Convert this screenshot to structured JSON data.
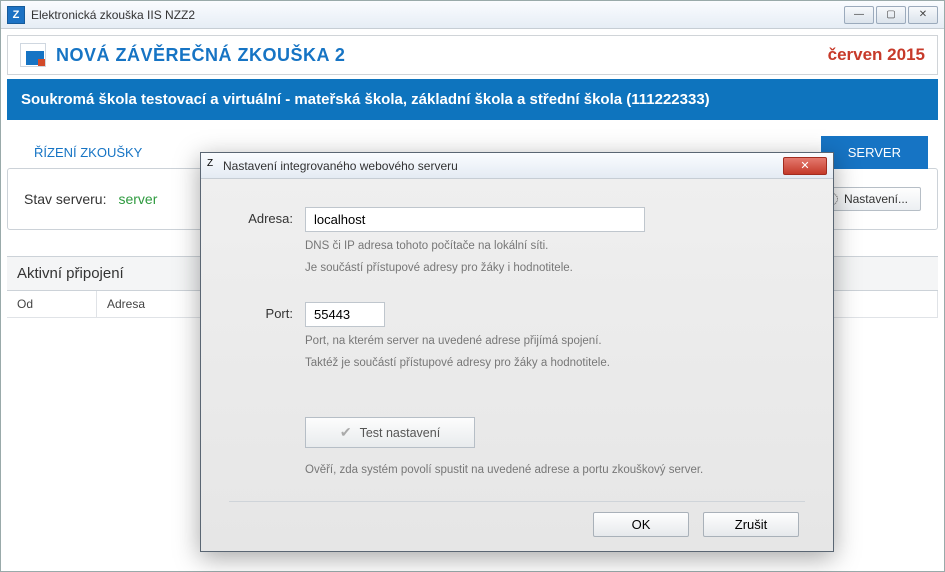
{
  "window": {
    "title": "Elektronická zkouška IIS NZZ2",
    "icon_text": "Z"
  },
  "header": {
    "title": "NOVÁ ZÁVĚREČNÁ ZKOUŠKA 2",
    "date": "červen 2015"
  },
  "subheader": "Soukromá škola testovací a virtuální - mateřská škola, základní škola a střední škola (111222333)",
  "tabs": {
    "left": "ŘÍZENÍ ZKOUŠKY",
    "server": "SERVER"
  },
  "server_status": {
    "label": "Stav serveru:",
    "value": "server",
    "settings_label": "Nastavení..."
  },
  "connections": {
    "title": "Aktivní připojení",
    "columns": {
      "od": "Od",
      "adresa": "Adresa"
    }
  },
  "dialog": {
    "title": "Nastavení integrovaného webového serveru",
    "address_label": "Adresa:",
    "address_value": "localhost",
    "address_hint1": "DNS či IP adresa tohoto počítače na lokální síti.",
    "address_hint2": "Je součástí přístupové adresy pro žáky i hodnotitele.",
    "port_label": "Port:",
    "port_value": "55443",
    "port_hint1": "Port, na kterém server na uvedené adrese přijímá spojení.",
    "port_hint2": "Taktéž je součástí přístupové adresy pro žáky a hodnotitele.",
    "test_label": "Test nastavení",
    "test_hint": "Ověří, zda systém povolí spustit na uvedené adrese a portu zkouškový server.",
    "ok": "OK",
    "cancel": "Zrušit"
  }
}
